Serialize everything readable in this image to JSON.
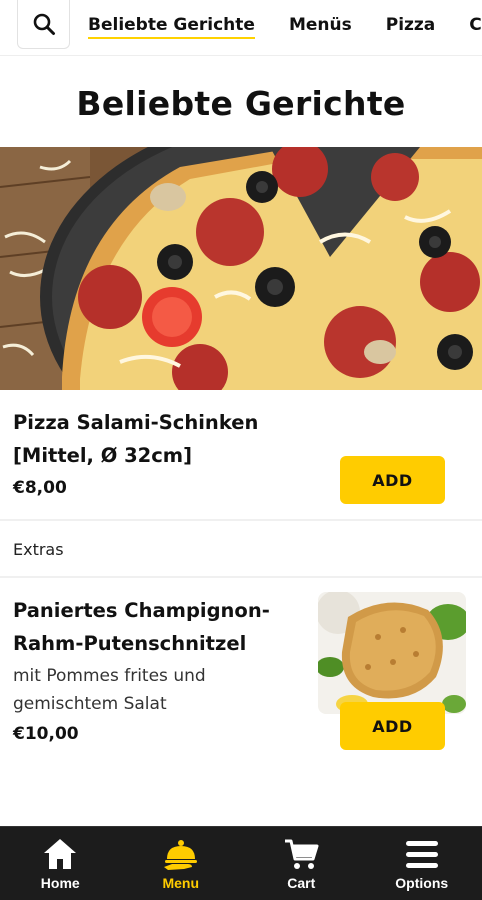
{
  "header": {
    "search_icon": "search-icon",
    "tabs": [
      {
        "label": "Beliebte Gerichte",
        "active": true
      },
      {
        "label": "Menüs",
        "active": false
      },
      {
        "label": "Pizza",
        "active": false
      },
      {
        "label": "Cal",
        "active": false
      }
    ]
  },
  "section": {
    "title": "Beliebte Gerichte"
  },
  "dishes": [
    {
      "name_line1": "Pizza Salami-Schinken",
      "name_line2": "[Mittel, Ø 32cm]",
      "price": "€8,00",
      "add_label": "ADD"
    },
    {
      "name_line1": "Paniertes Champignon-",
      "name_line2": "Rahm-Putenschnitzel",
      "desc_line1": "mit Pommes frites und",
      "desc_line2": "gemischtem Salat",
      "price": "€10,00",
      "add_label": "ADD"
    }
  ],
  "extras_label": "Extras",
  "colors": {
    "accent": "#ffcc00",
    "nav_bg": "#1c1c1c",
    "text": "#111111"
  },
  "nav": [
    {
      "label": "Home",
      "icon": "home-icon",
      "active": false
    },
    {
      "label": "Menu",
      "icon": "menu-cloche-icon",
      "active": true
    },
    {
      "label": "Cart",
      "icon": "cart-icon",
      "active": false
    },
    {
      "label": "Options",
      "icon": "hamburger-icon",
      "active": false
    }
  ]
}
